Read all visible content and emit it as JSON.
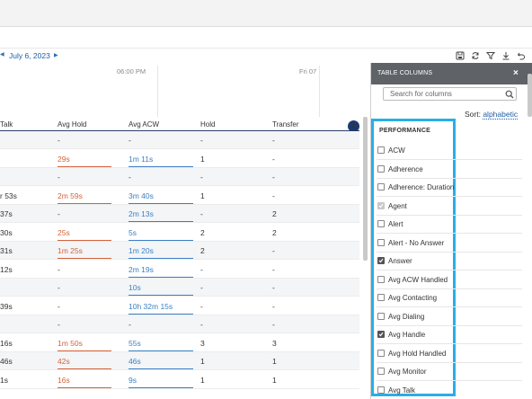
{
  "datebar": {
    "date": "July 6, 2023",
    "prev_icon": "triangle-left",
    "next_icon": "triangle-right"
  },
  "toolbar": {
    "icons": [
      "save-icon",
      "refresh-icon",
      "filter-icon",
      "download-icon",
      "undo-icon"
    ]
  },
  "timeline": {
    "labels": [
      "06:00 PM",
      "Fri 07"
    ]
  },
  "table": {
    "columns": [
      "Talk",
      "Avg Hold",
      "Avg ACW",
      "Hold",
      "Transfer"
    ],
    "rows": [
      [
        "",
        "-",
        "-",
        "-",
        "-"
      ],
      [
        "",
        "29s",
        "1m 11s",
        "1",
        "-"
      ],
      [
        "",
        "-",
        "-",
        "-",
        "-"
      ],
      [
        "r 53s",
        "2m 59s",
        "3m 40s",
        "1",
        "-"
      ],
      [
        "37s",
        "-",
        "2m 13s",
        "-",
        "2"
      ],
      [
        "30s",
        "25s",
        "5s",
        "2",
        "2"
      ],
      [
        "31s",
        "1m 25s",
        "1m 20s",
        "2",
        "-"
      ],
      [
        "12s",
        "-",
        "2m 19s",
        "-",
        "-"
      ],
      [
        "",
        "-",
        "10s",
        "-",
        "-"
      ],
      [
        "39s",
        "-",
        "10h 32m 15s",
        "-",
        "-"
      ],
      [
        "",
        "-",
        "-",
        "-",
        "-"
      ],
      [
        "16s",
        "1m 50s",
        "55s",
        "3",
        "3"
      ],
      [
        "46s",
        "42s",
        "46s",
        "1",
        "1"
      ],
      [
        "1s",
        "16s",
        "9s",
        "1",
        "1"
      ]
    ]
  },
  "panel": {
    "title": "TABLE COLUMNS",
    "close_label": "×",
    "search_placeholder": "Search for columns",
    "sort_label": "Sort:",
    "sort_value": "alphabetic",
    "section": "PERFORMANCE",
    "items": [
      {
        "label": "ACW",
        "checked": false,
        "disabled": false
      },
      {
        "label": "Adherence",
        "checked": false,
        "disabled": false
      },
      {
        "label": "Adherence: Duration",
        "checked": false,
        "disabled": false
      },
      {
        "label": "Agent",
        "checked": true,
        "disabled": true
      },
      {
        "label": "Alert",
        "checked": false,
        "disabled": false
      },
      {
        "label": "Alert - No Answer",
        "checked": false,
        "disabled": false
      },
      {
        "label": "Answer",
        "checked": true,
        "disabled": false
      },
      {
        "label": "Avg ACW Handled",
        "checked": false,
        "disabled": false
      },
      {
        "label": "Avg Contacting",
        "checked": false,
        "disabled": false
      },
      {
        "label": "Avg Dialing",
        "checked": false,
        "disabled": false
      },
      {
        "label": "Avg Handle",
        "checked": true,
        "disabled": false
      },
      {
        "label": "Avg Hold Handled",
        "checked": false,
        "disabled": false
      },
      {
        "label": "Avg Monitor",
        "checked": false,
        "disabled": false
      },
      {
        "label": "Avg Talk",
        "checked": false,
        "disabled": false
      }
    ]
  },
  "colors": {
    "accent": "#1d5ea8",
    "hold_red": "#d4623a",
    "acw_blue": "#3b7fc4",
    "highlight": "#29aee6",
    "panel_header": "#5f6368"
  }
}
